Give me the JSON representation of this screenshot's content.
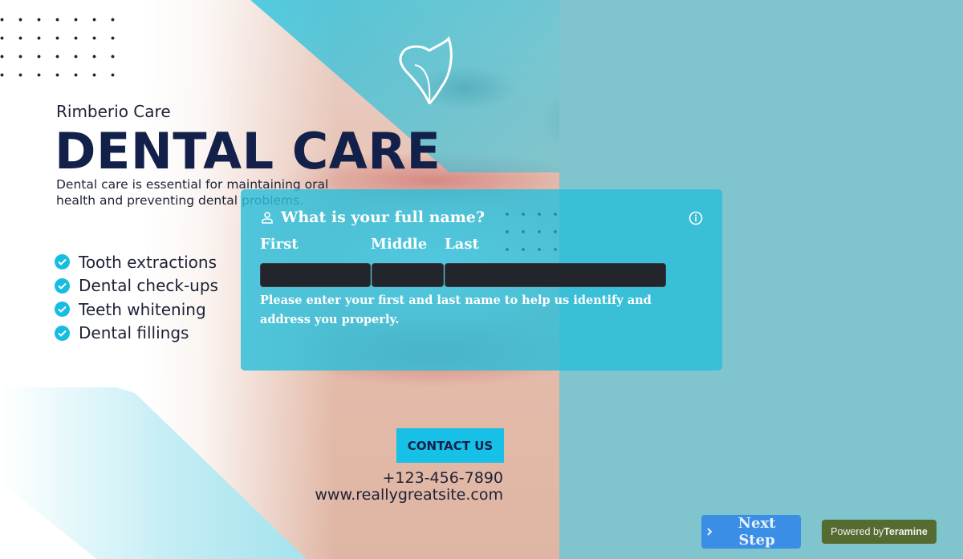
{
  "poster": {
    "brand": "Rimberio Care",
    "headline": "DENTAL CARE",
    "lead": "Dental care is essential for maintaining oral health and preventing dental problems.",
    "services": [
      "Tooth extractions",
      "Dental check-ups",
      "Teeth whitening",
      "Dental fillings"
    ],
    "contact_label": "CONTACT US",
    "phone": "+123-456-7890",
    "website": "www.reallygreatsite.com",
    "icons": {
      "logo": "tooth-icon",
      "bullet": "check-circle-icon"
    }
  },
  "form": {
    "question": "What is your full name?",
    "question_icon": "person-icon",
    "info_icon": "info-icon",
    "fields": {
      "first": {
        "label": "First",
        "value": "",
        "placeholder": ""
      },
      "middle": {
        "label": "Middle",
        "value": "",
        "placeholder": ""
      },
      "last": {
        "label": "Last",
        "value": "",
        "placeholder": ""
      }
    },
    "help_text": "Please enter your first and last name to help us identify and address you properly."
  },
  "footer": {
    "next_label": "Next Step",
    "next_icon": "chevron-right-icon",
    "powered_prefix": "Powered by",
    "powered_brand": "Teramine"
  },
  "colors": {
    "accent_cyan": "#16c0e6",
    "navy": "#13214a",
    "page_bg": "#80c4cd",
    "card_bg": "#2bbedb",
    "next_button": "#3a8ee6",
    "powered_badge": "#556b2f",
    "input_bg": "#22252b"
  }
}
